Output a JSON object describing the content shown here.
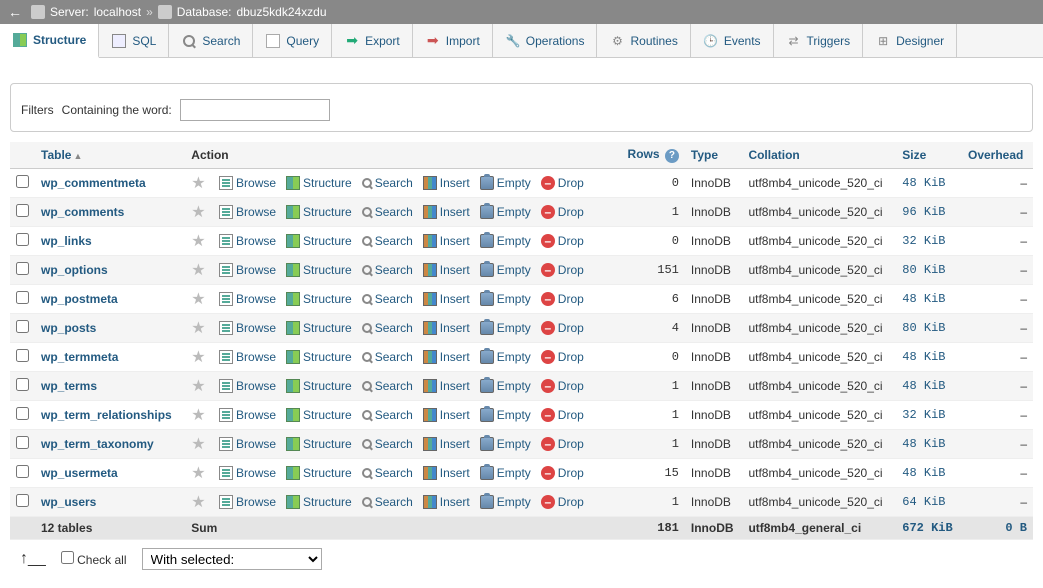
{
  "breadcrumb": {
    "server_label": "Server:",
    "server_name": "localhost",
    "database_label": "Database:",
    "database_name": "dbuz5kdk24xzdu"
  },
  "tabs": [
    {
      "id": "structure",
      "label": "Structure",
      "active": true
    },
    {
      "id": "sql",
      "label": "SQL"
    },
    {
      "id": "search",
      "label": "Search"
    },
    {
      "id": "query",
      "label": "Query"
    },
    {
      "id": "export",
      "label": "Export"
    },
    {
      "id": "import",
      "label": "Import"
    },
    {
      "id": "operations",
      "label": "Operations"
    },
    {
      "id": "routines",
      "label": "Routines"
    },
    {
      "id": "events",
      "label": "Events"
    },
    {
      "id": "triggers",
      "label": "Triggers"
    },
    {
      "id": "designer",
      "label": "Designer"
    }
  ],
  "filters": {
    "legend": "Filters",
    "label": "Containing the word:",
    "value": ""
  },
  "headers": {
    "table": "Table",
    "action": "Action",
    "rows": "Rows",
    "type": "Type",
    "collation": "Collation",
    "size": "Size",
    "overhead": "Overhead"
  },
  "action_labels": {
    "browse": "Browse",
    "structure": "Structure",
    "search": "Search",
    "insert": "Insert",
    "empty": "Empty",
    "drop": "Drop"
  },
  "tables": [
    {
      "name": "wp_commentmeta",
      "rows": 0,
      "type": "InnoDB",
      "collation": "utf8mb4_unicode_520_ci",
      "size": "48 KiB",
      "overhead": "–"
    },
    {
      "name": "wp_comments",
      "rows": 1,
      "type": "InnoDB",
      "collation": "utf8mb4_unicode_520_ci",
      "size": "96 KiB",
      "overhead": "–"
    },
    {
      "name": "wp_links",
      "rows": 0,
      "type": "InnoDB",
      "collation": "utf8mb4_unicode_520_ci",
      "size": "32 KiB",
      "overhead": "–"
    },
    {
      "name": "wp_options",
      "rows": 151,
      "type": "InnoDB",
      "collation": "utf8mb4_unicode_520_ci",
      "size": "80 KiB",
      "overhead": "–"
    },
    {
      "name": "wp_postmeta",
      "rows": 6,
      "type": "InnoDB",
      "collation": "utf8mb4_unicode_520_ci",
      "size": "48 KiB",
      "overhead": "–"
    },
    {
      "name": "wp_posts",
      "rows": 4,
      "type": "InnoDB",
      "collation": "utf8mb4_unicode_520_ci",
      "size": "80 KiB",
      "overhead": "–"
    },
    {
      "name": "wp_termmeta",
      "rows": 0,
      "type": "InnoDB",
      "collation": "utf8mb4_unicode_520_ci",
      "size": "48 KiB",
      "overhead": "–"
    },
    {
      "name": "wp_terms",
      "rows": 1,
      "type": "InnoDB",
      "collation": "utf8mb4_unicode_520_ci",
      "size": "48 KiB",
      "overhead": "–"
    },
    {
      "name": "wp_term_relationships",
      "rows": 1,
      "type": "InnoDB",
      "collation": "utf8mb4_unicode_520_ci",
      "size": "32 KiB",
      "overhead": "–"
    },
    {
      "name": "wp_term_taxonomy",
      "rows": 1,
      "type": "InnoDB",
      "collation": "utf8mb4_unicode_520_ci",
      "size": "48 KiB",
      "overhead": "–"
    },
    {
      "name": "wp_usermeta",
      "rows": 15,
      "type": "InnoDB",
      "collation": "utf8mb4_unicode_520_ci",
      "size": "48 KiB",
      "overhead": "–"
    },
    {
      "name": "wp_users",
      "rows": 1,
      "type": "InnoDB",
      "collation": "utf8mb4_unicode_520_ci",
      "size": "64 KiB",
      "overhead": "–"
    }
  ],
  "summary": {
    "count_label": "12 tables",
    "sum_label": "Sum",
    "rows": 181,
    "type": "InnoDB",
    "collation": "utf8mb4_general_ci",
    "size": "672 KiB",
    "overhead": "0 B"
  },
  "footer": {
    "check_all": "Check all",
    "with_selected": "With selected:"
  }
}
